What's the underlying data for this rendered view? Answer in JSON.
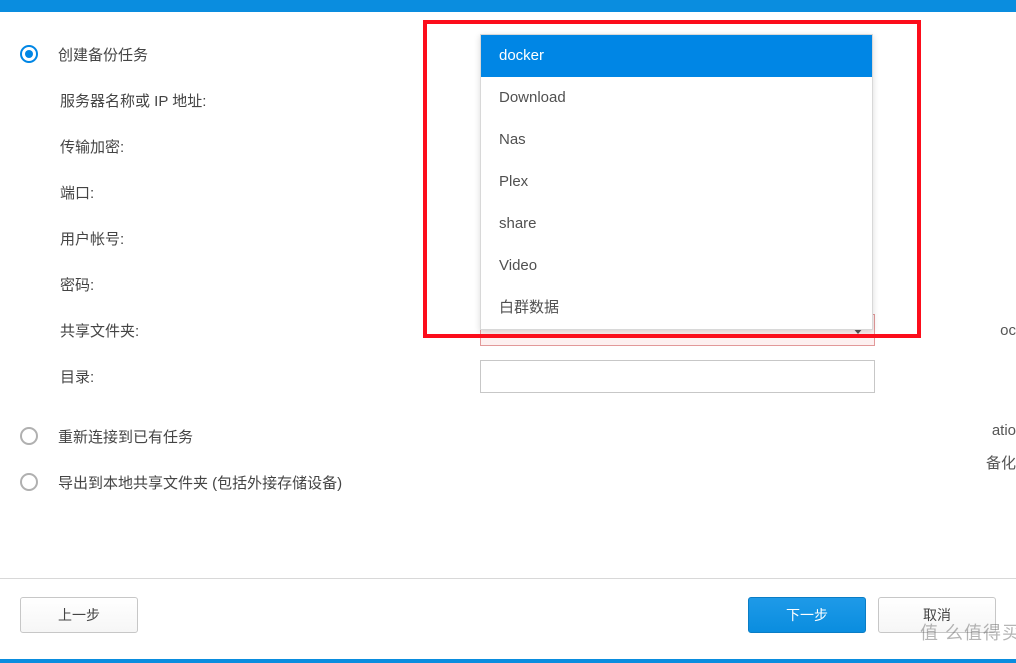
{
  "options": {
    "create_backup": "创建备份任务",
    "relink_existing": "重新连接到已有任务",
    "export_local": "导出到本地共享文件夹 (包括外接存储设备)"
  },
  "fields": {
    "server_label": "服务器名称或 IP 地址:",
    "encryption_label": "传输加密:",
    "port_label": "端口:",
    "username_label": "用户帐号:",
    "password_label": "密码:",
    "shared_folder_label": "共享文件夹:",
    "directory_label": "目录:",
    "directory_value": ""
  },
  "dropdown": {
    "items": [
      "docker",
      "Download",
      "Nas",
      "Plex",
      "share",
      "Video",
      "白群数据"
    ],
    "selected_index": 0
  },
  "buttons": {
    "prev": "上一步",
    "next": "下一步",
    "cancel": "取消"
  },
  "background_text": {
    "t1": "oc",
    "t2": "atio",
    "t3": "备化"
  },
  "watermark": "值  么值得买"
}
